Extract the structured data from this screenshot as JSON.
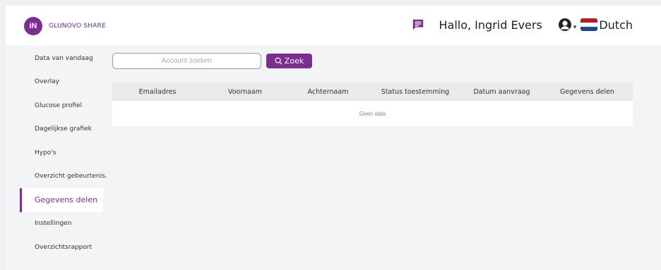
{
  "header": {
    "brand": "GLUNOVO SHARE",
    "logo_letters": "iN",
    "greeting": "Hallo, Ingrid Evers",
    "language": "Dutch",
    "icons": [
      "message-icon",
      "user-icon",
      "chevron-down-icon",
      "flag-nl-icon"
    ]
  },
  "sidebar": {
    "items": [
      {
        "label": "Data van vandaag"
      },
      {
        "label": "Overlay"
      },
      {
        "label": "Glucose profiel"
      },
      {
        "label": "Dagelijkse grafiek"
      },
      {
        "label": "Hypo's"
      },
      {
        "label": "Overzicht gebeurtenis..."
      },
      {
        "label": "Gegevens delen",
        "active": true
      },
      {
        "label": "Instellingen"
      },
      {
        "label": "Overzichtsrapport"
      }
    ]
  },
  "search": {
    "placeholder": "Account zoeken",
    "button_label": "Zoek"
  },
  "table": {
    "columns": [
      "Emailadres",
      "Voornaam",
      "Achternaam",
      "Status toestemming",
      "Datum aanvraag",
      "Gegevens delen"
    ],
    "empty_text": "Geen data"
  },
  "colors": {
    "accent": "#7b2d91",
    "flag": [
      "#ae1c28",
      "#ffffff",
      "#21468b"
    ]
  }
}
